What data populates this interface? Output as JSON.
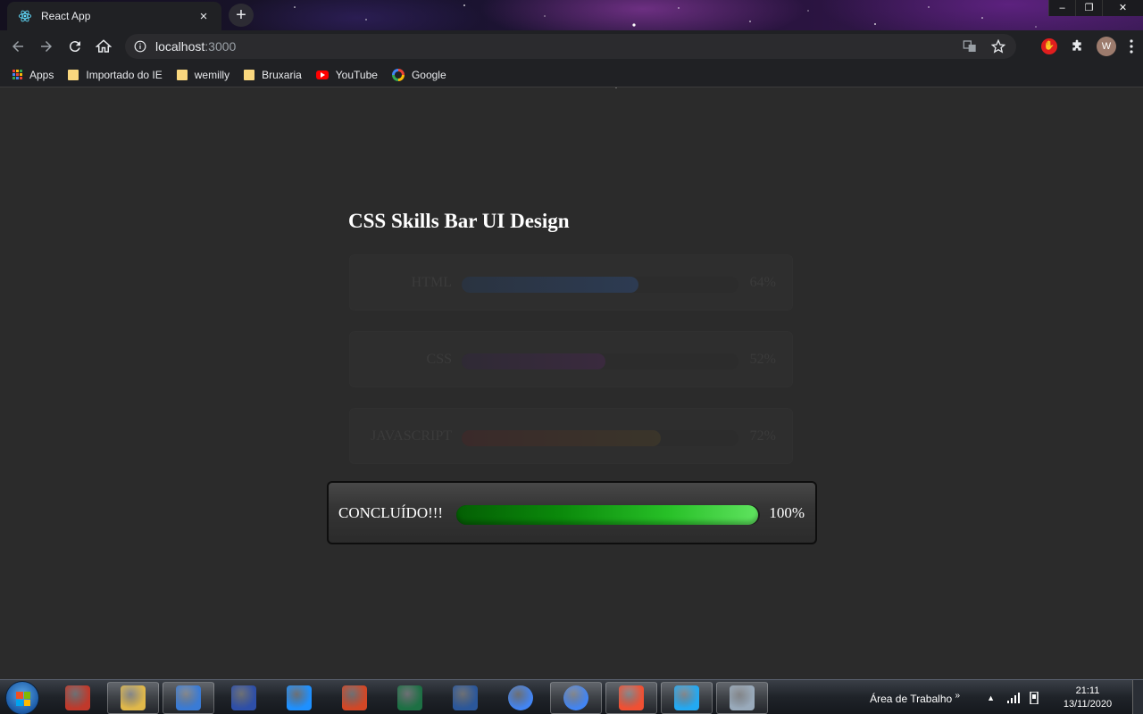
{
  "browser": {
    "tab_title": "React App",
    "tab_close": "×",
    "new_tab": "+",
    "url_host": "localhost",
    "url_port": ":3000",
    "avatar_letter": "W",
    "window_controls": [
      "‒",
      "❐",
      "✕"
    ]
  },
  "bookmarks": [
    {
      "label": "Apps",
      "icon": "apps-grid-icon"
    },
    {
      "label": "Importado do IE",
      "icon": "folder-icon"
    },
    {
      "label": "wemilly",
      "icon": "folder-icon"
    },
    {
      "label": "Bruxaria",
      "icon": "folder-icon"
    },
    {
      "label": "YouTube",
      "icon": "youtube-icon"
    },
    {
      "label": "Google",
      "icon": "google-icon"
    }
  ],
  "page": {
    "title": "CSS Skills Bar UI Design",
    "skills": [
      {
        "name": "HTML",
        "percent_label": "64%",
        "level": 0.64,
        "colors": [
          "#2a3340",
          "#2d3b52"
        ]
      },
      {
        "name": "CSS",
        "percent_label": "52%",
        "level": 0.52,
        "colors": [
          "#2f2a35",
          "#3a2a3e"
        ]
      },
      {
        "name": "JAVASCRIPT",
        "percent_label": "72%",
        "level": 0.72,
        "colors": [
          "#3a2a2a",
          "#3a352a"
        ]
      }
    ],
    "modal": {
      "label": "CONCLUÍDO!!!",
      "percent_label": "100%",
      "level": 1.0
    }
  },
  "taskbar": {
    "desktop_label": "Área de Trabalho",
    "desktop_chevron": "»",
    "time": "21:11",
    "date": "13/11/2020",
    "apps": [
      {
        "name": "snipping-tool-icon",
        "color": "#c0392b"
      },
      {
        "name": "file-explorer-icon",
        "color": "#e0b84a"
      },
      {
        "name": "media-player-icon",
        "color": "#3a7bd5"
      },
      {
        "name": "scanner-app-icon",
        "color": "#2e4fa8"
      },
      {
        "name": "internet-explorer-icon",
        "color": "#1e90ff"
      },
      {
        "name": "powerpoint-icon",
        "color": "#d24726"
      },
      {
        "name": "excel-icon",
        "color": "#1d7044"
      },
      {
        "name": "word-icon",
        "color": "#2b579a"
      },
      {
        "name": "chrome-icon",
        "color": "#4285f4"
      },
      {
        "name": "chrome-profile-icon",
        "color": "#4285f4"
      },
      {
        "name": "git-icon",
        "color": "#f05033"
      },
      {
        "name": "vscode-icon",
        "color": "#23a9f2"
      },
      {
        "name": "paint-icon",
        "color": "#9ab"
      }
    ]
  }
}
